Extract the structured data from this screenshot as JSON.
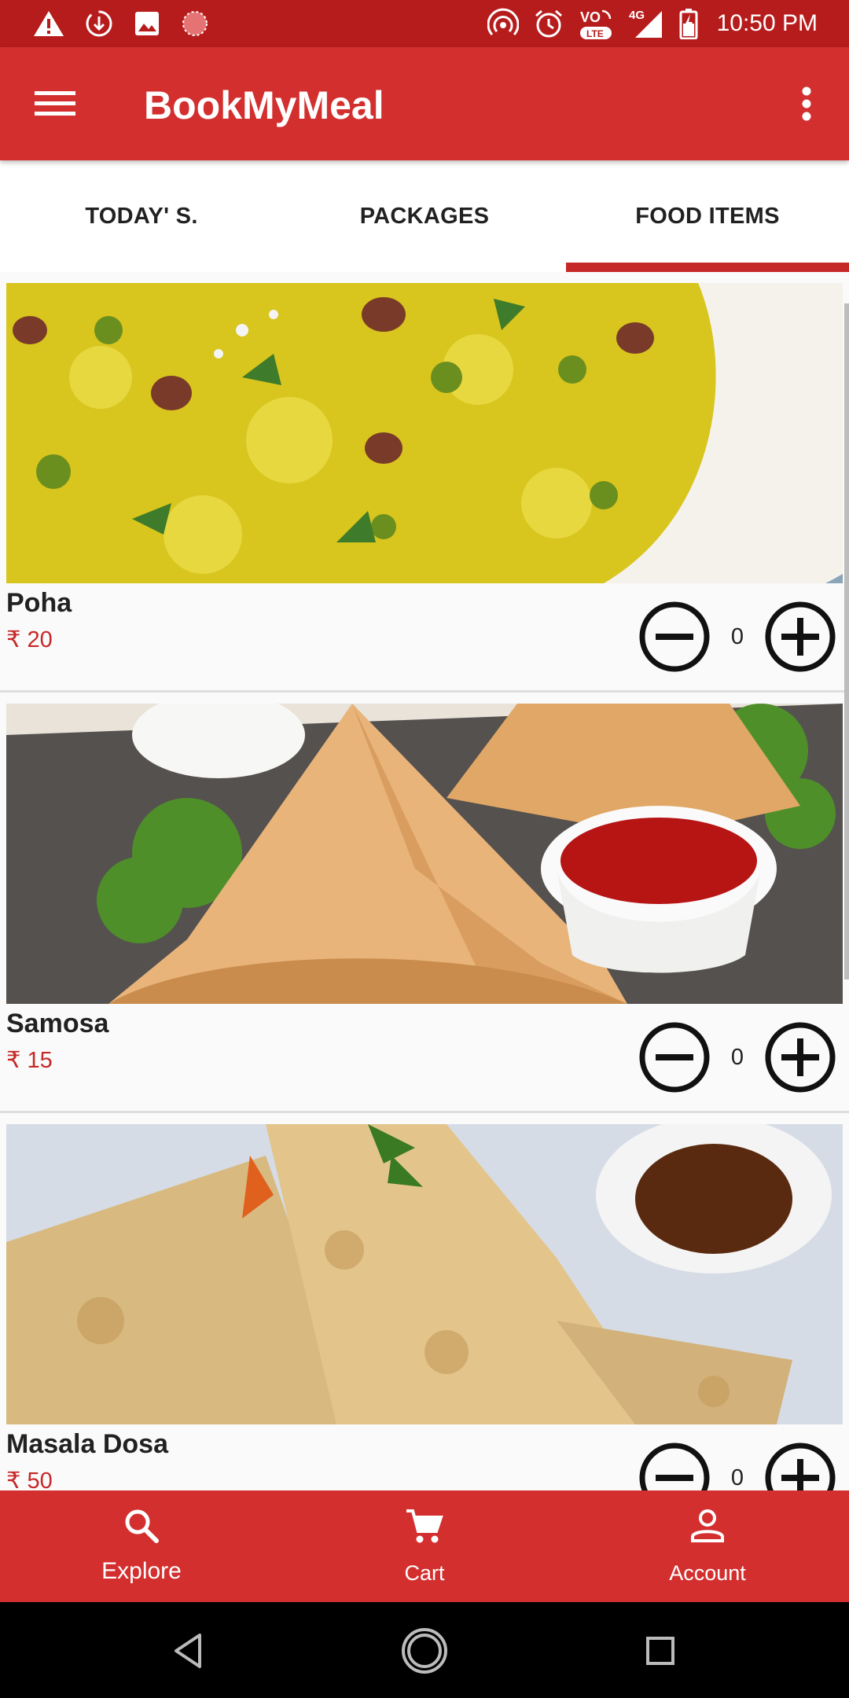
{
  "status_bar": {
    "time": "10:50 PM",
    "network": "4G",
    "volte_label": "LTE",
    "left_icons": [
      "warning-icon",
      "download-icon",
      "image-icon",
      "loading-icon"
    ],
    "right_icons": [
      "hotspot-icon",
      "alarm-icon",
      "volte-icon",
      "signal-icon",
      "battery-icon"
    ]
  },
  "app_bar": {
    "title": "BookMyMeal",
    "menu_icon": "hamburger-menu-icon",
    "overflow_icon": "more-vert-icon"
  },
  "tabs": [
    {
      "label": "TODAY' S.",
      "selected": false
    },
    {
      "label": "PACKAGES",
      "selected": false
    },
    {
      "label": "FOOD ITEMS",
      "selected": true
    }
  ],
  "food_items": [
    {
      "name": "Poha",
      "price": "₹ 20",
      "quantity": "0"
    },
    {
      "name": "Samosa",
      "price": "₹ 15",
      "quantity": "0"
    },
    {
      "name": "Masala Dosa",
      "price": "₹ 50",
      "quantity": "0"
    }
  ],
  "bottom_nav": [
    {
      "label": "Explore",
      "icon": "search-icon"
    },
    {
      "label": "Cart",
      "icon": "cart-icon"
    },
    {
      "label": "Account",
      "icon": "person-icon"
    }
  ],
  "system_nav": [
    "back-icon",
    "home-icon",
    "recent-apps-icon"
  ],
  "colors": {
    "status_bar": "#b71c1c",
    "primary": "#d32f2f",
    "accent": "#c62828",
    "price_text": "#c62828"
  }
}
